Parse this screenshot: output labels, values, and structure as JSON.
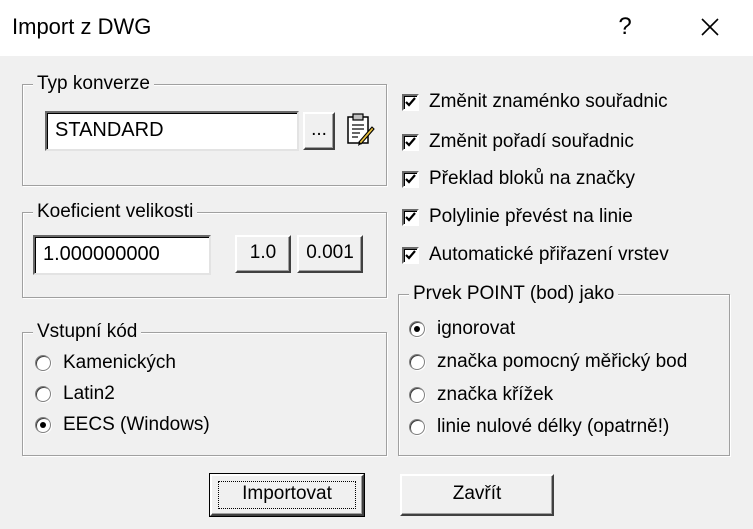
{
  "window": {
    "title": "Import z DWG",
    "help_label": "?"
  },
  "conversion": {
    "legend": "Typ konverze",
    "value": "STANDARD",
    "browse_label": "...",
    "icon": "clipboard-edit-icon"
  },
  "scale": {
    "legend": "Koeficient velikosti",
    "value": "1.000000000",
    "btn_1": "1.0",
    "btn_2": "0.001"
  },
  "encoding": {
    "legend": "Vstupní kód",
    "options": [
      {
        "label": "Kamenických",
        "selected": false
      },
      {
        "label": "Latin2",
        "selected": false
      },
      {
        "label": "EECS (Windows)",
        "selected": true
      }
    ]
  },
  "options": [
    {
      "label": "Změnit znaménko souřadnic",
      "checked": true
    },
    {
      "label": "Změnit pořadí souřadnic",
      "checked": true
    },
    {
      "label": "Překlad bloků na značky",
      "checked": true
    },
    {
      "label": "Polylinie převést na linie",
      "checked": true
    },
    {
      "label": "Automatické přiřazení vrstev",
      "checked": true
    }
  ],
  "point": {
    "legend": "Prvek POINT (bod) jako",
    "options": [
      {
        "label": "ignorovat",
        "selected": true
      },
      {
        "label": "značka pomocný měřický bod",
        "selected": false
      },
      {
        "label": "značka křížek",
        "selected": false
      },
      {
        "label": "linie nulové délky (opatrně!)",
        "selected": false
      }
    ]
  },
  "buttons": {
    "import": "Importovat",
    "close": "Zavřít"
  }
}
